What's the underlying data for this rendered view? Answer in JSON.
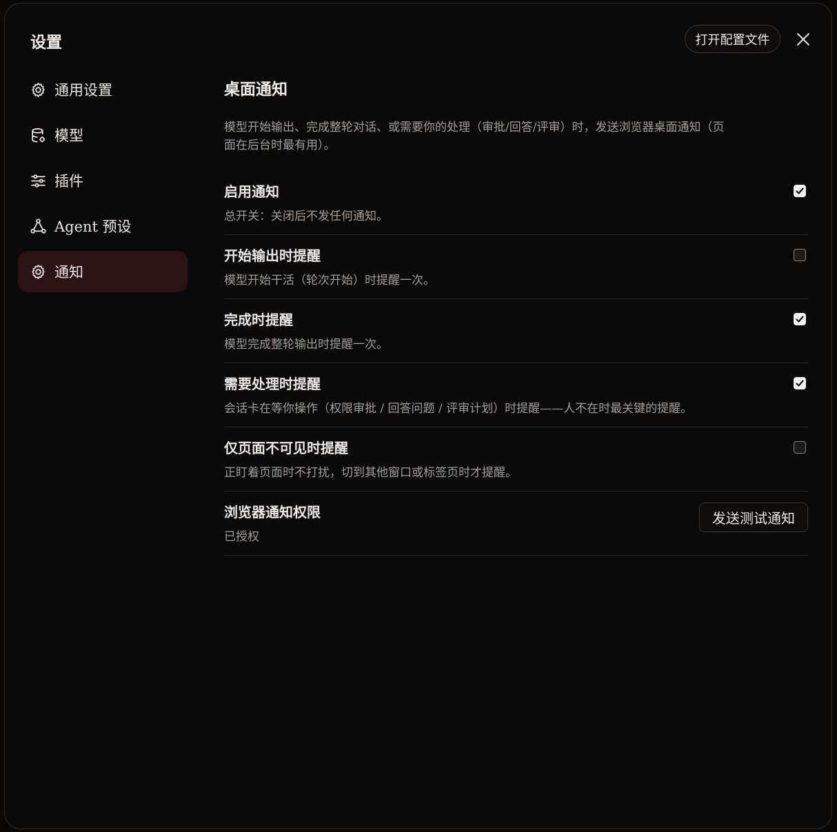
{
  "dialog": {
    "title": "设置",
    "open_config_label": "打开配置文件"
  },
  "sidebar": {
    "items": [
      {
        "label": "通用设置",
        "icon": "gear-icon"
      },
      {
        "label": "模型",
        "icon": "database-icon"
      },
      {
        "label": "插件",
        "icon": "sliders-icon"
      },
      {
        "label": "Agent 预设",
        "icon": "nodes-icon"
      },
      {
        "label": "通知",
        "icon": "gear-icon",
        "active": true
      }
    ]
  },
  "main": {
    "title": "桌面通知",
    "description": "模型开始输出、完成整轮对话、或需要你的处理（审批/回答/评审）时，发送浏览器桌面通知（页面在后台时最有用）。",
    "settings": [
      {
        "title": "启用通知",
        "desc": "总开关：关闭后不发任何通知。",
        "checked": true
      },
      {
        "title": "开始输出时提醒",
        "desc": "模型开始干活（轮次开始）时提醒一次。",
        "checked": false
      },
      {
        "title": "完成时提醒",
        "desc": "模型完成整轮输出时提醒一次。",
        "checked": true
      },
      {
        "title": "需要处理时提醒",
        "desc": "会话卡在等你操作（权限审批 / 回答问题 / 评审计划）时提醒——人不在时最关键的提醒。",
        "checked": true
      },
      {
        "title": "仅页面不可见时提醒",
        "desc": "正盯着页面时不打扰，切到其他窗口或标签页时才提醒。",
        "checked": false
      }
    ],
    "permission": {
      "title": "浏览器通知权限",
      "status": "已授权",
      "test_button_label": "发送测试通知"
    }
  },
  "colors": {
    "active_nav_bg": "#2a1312",
    "background": "#0b0a0a",
    "muted_text": "#a39d99"
  }
}
